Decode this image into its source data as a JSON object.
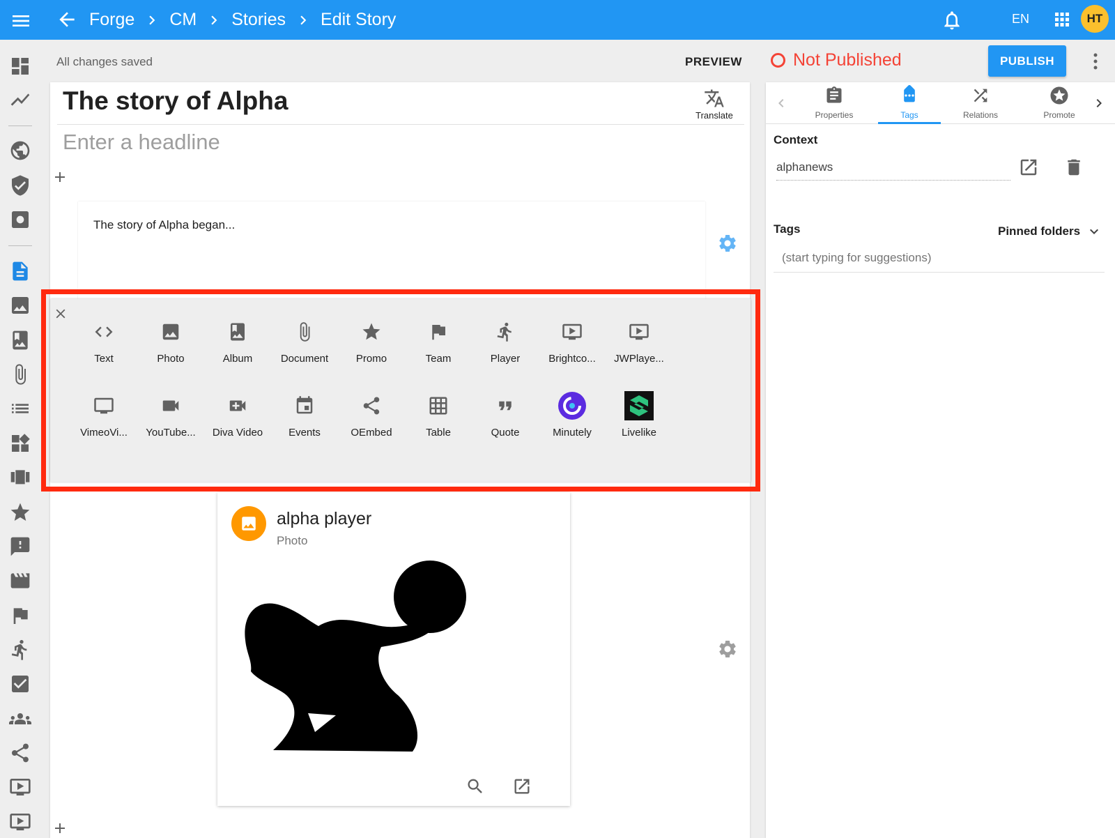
{
  "app": {
    "breadcrumbs": [
      "Forge",
      "CM",
      "Stories",
      "Edit Story"
    ],
    "language": "EN",
    "user_initials": "HT"
  },
  "status": {
    "saved_text": "All changes saved",
    "preview_label": "PREVIEW",
    "publish_state": "Not Published",
    "publish_label": "PUBLISH"
  },
  "editor": {
    "title": "The story of Alpha",
    "headline_placeholder": "Enter a headline",
    "translate_label": "Translate",
    "text_block": "The story of Alpha began..."
  },
  "insert_menu": {
    "row1": [
      {
        "label": "Text",
        "icon": "code-icon"
      },
      {
        "label": "Photo",
        "icon": "image-icon"
      },
      {
        "label": "Album",
        "icon": "album-icon"
      },
      {
        "label": "Document",
        "icon": "paperclip-icon"
      },
      {
        "label": "Promo",
        "icon": "star-icon"
      },
      {
        "label": "Team",
        "icon": "flag-icon"
      },
      {
        "label": "Player",
        "icon": "player-icon"
      },
      {
        "label": "Brightco...",
        "icon": "video-icon"
      },
      {
        "label": "JWPlaye...",
        "icon": "video-icon"
      }
    ],
    "row2": [
      {
        "label": "VimeoVi...",
        "icon": "monitor-icon"
      },
      {
        "label": "YouTube...",
        "icon": "camera-icon"
      },
      {
        "label": "Diva Video",
        "icon": "video-add-icon"
      },
      {
        "label": "Events",
        "icon": "calendar-icon"
      },
      {
        "label": "OEmbed",
        "icon": "share-icon"
      },
      {
        "label": "Table",
        "icon": "table-icon"
      },
      {
        "label": "Quote",
        "icon": "quote-icon"
      },
      {
        "label": "Minutely",
        "icon": "minutely-logo-icon"
      },
      {
        "label": "Livelike",
        "icon": "livelike-logo-icon"
      }
    ]
  },
  "photo_card": {
    "title": "alpha player",
    "type": "Photo"
  },
  "right_panel": {
    "tabs": [
      "Properties",
      "Tags",
      "Relations",
      "Promote"
    ],
    "active_tab": "Tags",
    "context_label": "Context",
    "context_value": "alphanews",
    "tags_label": "Tags",
    "pinned_label": "Pinned folders",
    "tags_placeholder": "(start typing for suggestions)"
  },
  "colors": {
    "primary": "#2196f3",
    "danger": "#f44336",
    "highlight": "#ff2a0f",
    "avatar": "#fbc02d",
    "photo_badge": "#ff9800"
  }
}
